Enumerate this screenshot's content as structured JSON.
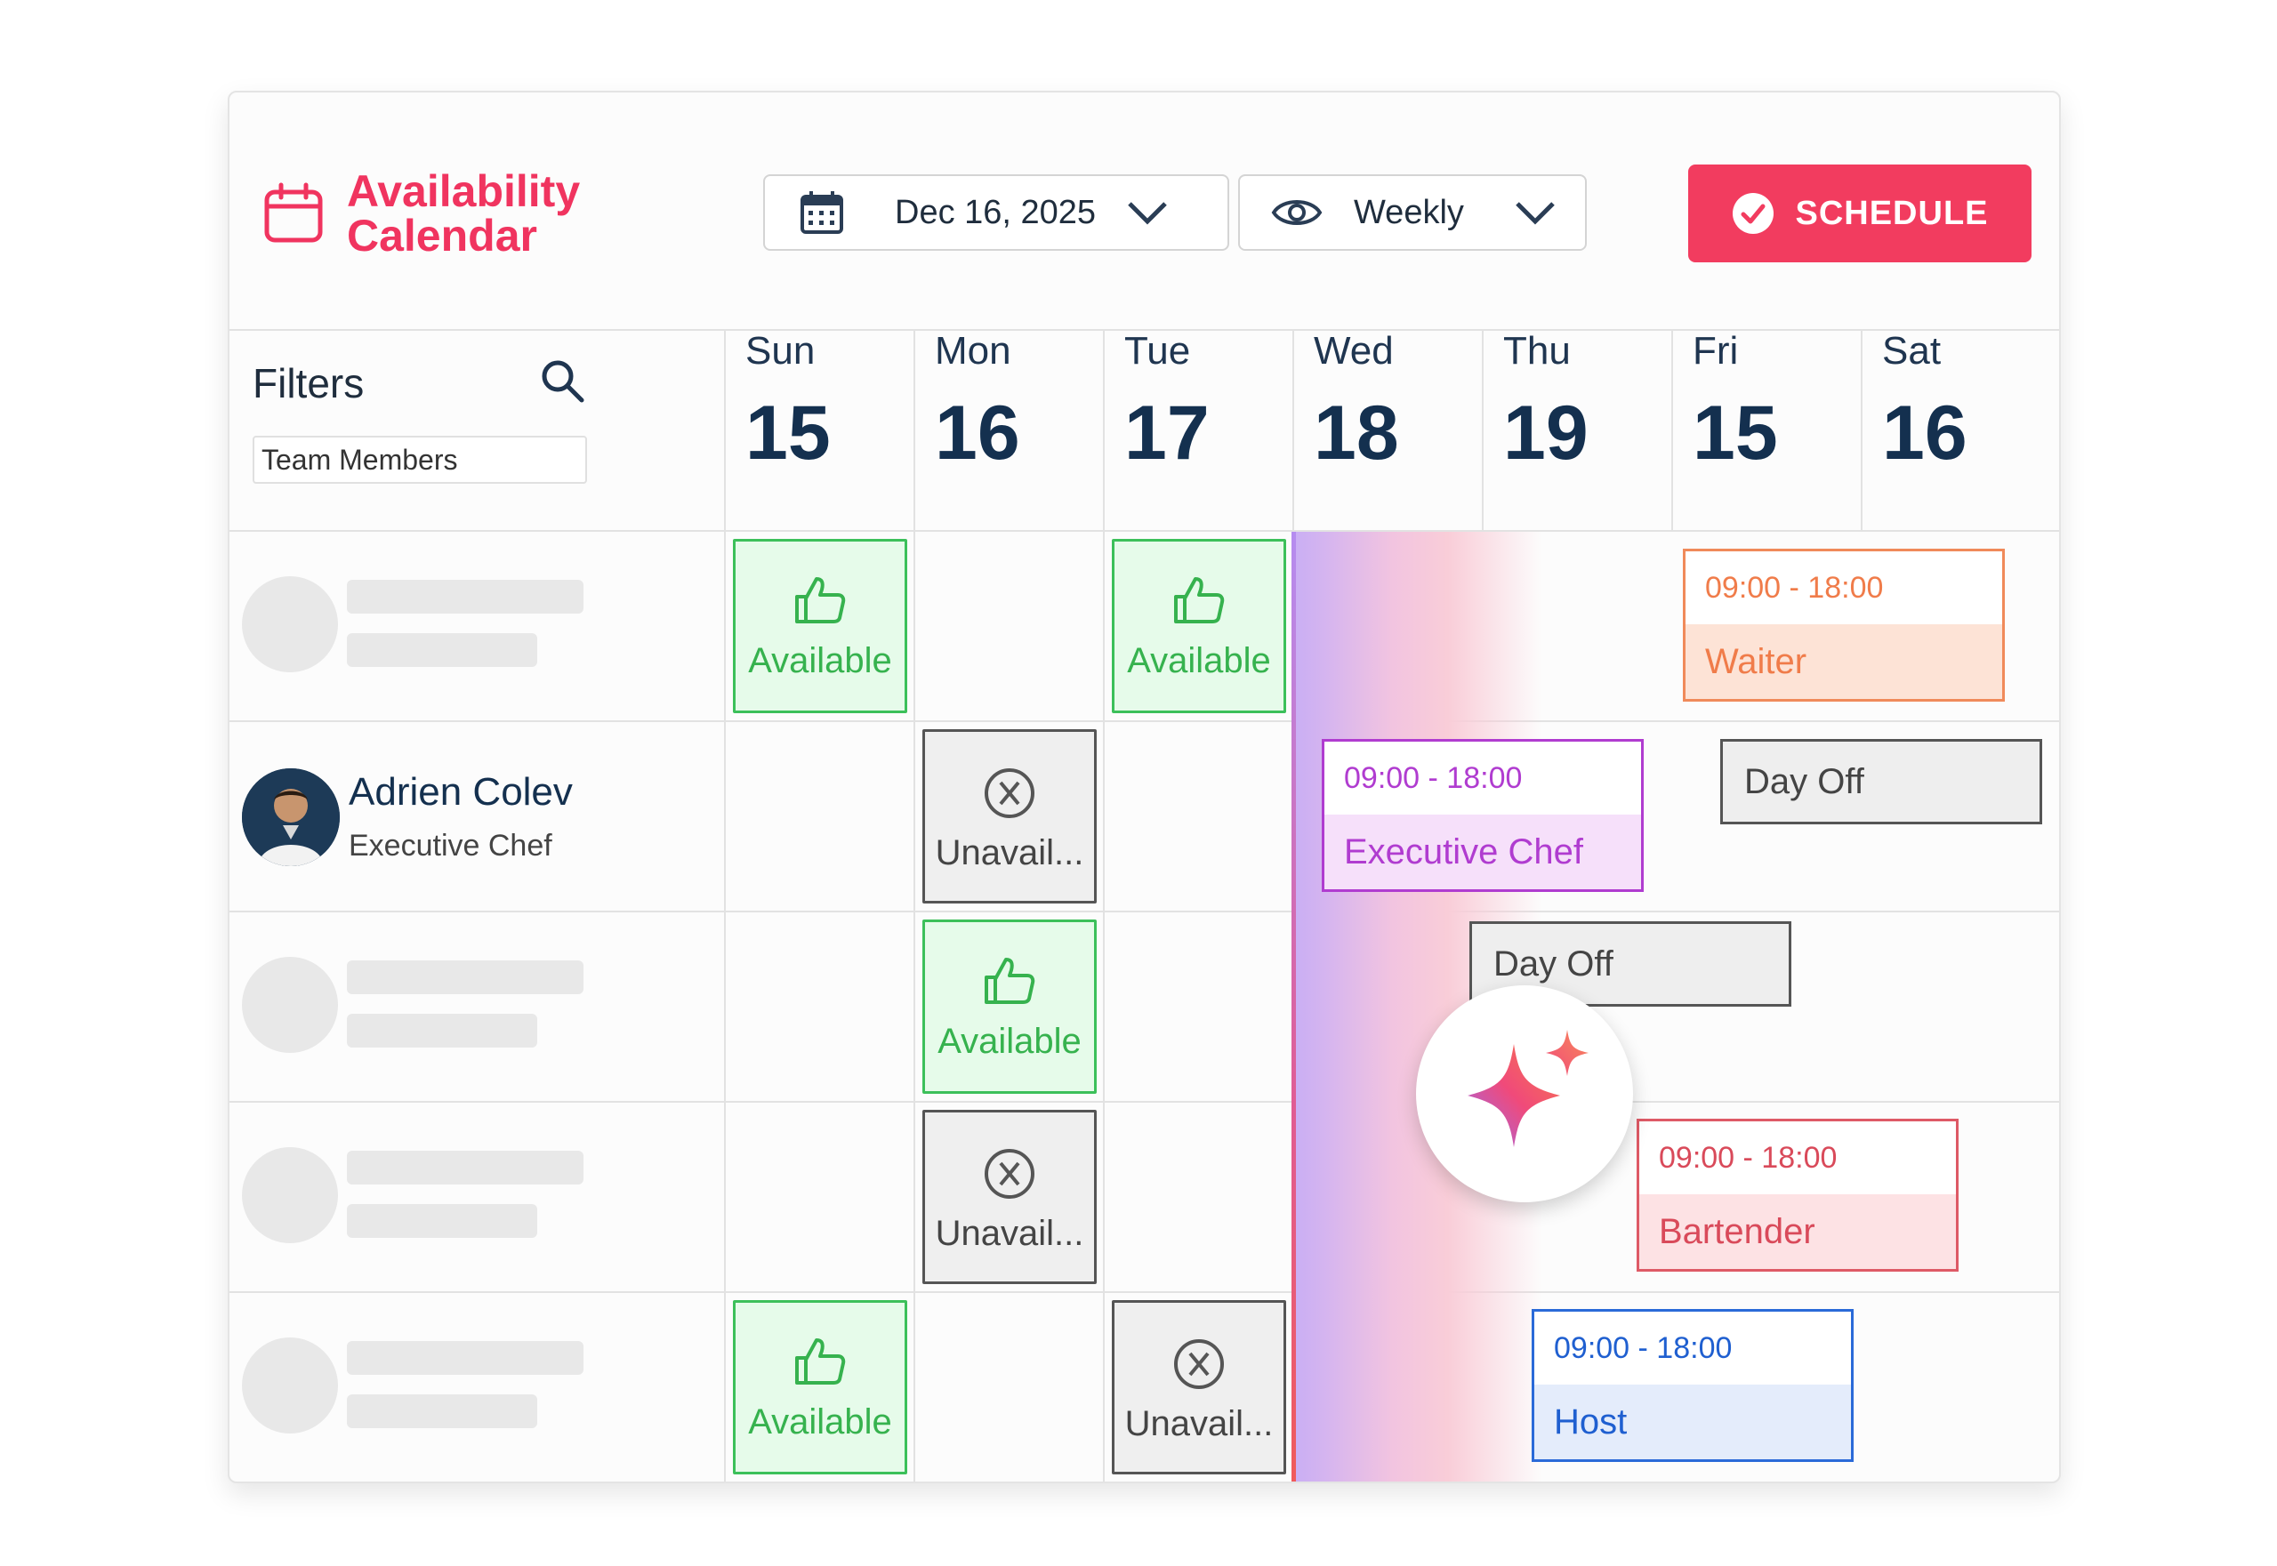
{
  "app": {
    "title": "Availability Calendar",
    "title_line1": "Availability",
    "title_line2": "Calendar"
  },
  "toolbar": {
    "date_value": "Dec 16, 2025",
    "view_value": "Weekly",
    "schedule_label": "SCHEDULE"
  },
  "filters": {
    "label": "Filters",
    "member_placeholder": "Team Members"
  },
  "days": [
    {
      "dow": "Sun",
      "num": "15"
    },
    {
      "dow": "Mon",
      "num": "16"
    },
    {
      "dow": "Tue",
      "num": "17"
    },
    {
      "dow": "Wed",
      "num": "18"
    },
    {
      "dow": "Thu",
      "num": "19"
    },
    {
      "dow": "Fri",
      "num": "15"
    },
    {
      "dow": "Sat",
      "num": "16"
    }
  ],
  "person": {
    "name": "Adrien Colev",
    "role": "Executive Chef"
  },
  "status": {
    "available": "Available",
    "unavailable": "Unavail...",
    "day_off": "Day Off"
  },
  "shifts": {
    "waiter": {
      "time": "09:00 - 18:00",
      "role": "Waiter"
    },
    "exec_chef": {
      "time": "09:00 - 18:00",
      "role": "Executive Chef"
    },
    "bartender": {
      "time": "09:00 - 18:00",
      "role": "Bartender"
    },
    "host": {
      "time": "09:00 - 18:00",
      "role": "Host"
    }
  },
  "colors": {
    "accent": "#f23c5f",
    "available": "#36b24e",
    "waiter": "#f07c4a",
    "exec_chef": "#b03cd0",
    "bartender": "#d94a5a",
    "host": "#1f5fd0"
  }
}
